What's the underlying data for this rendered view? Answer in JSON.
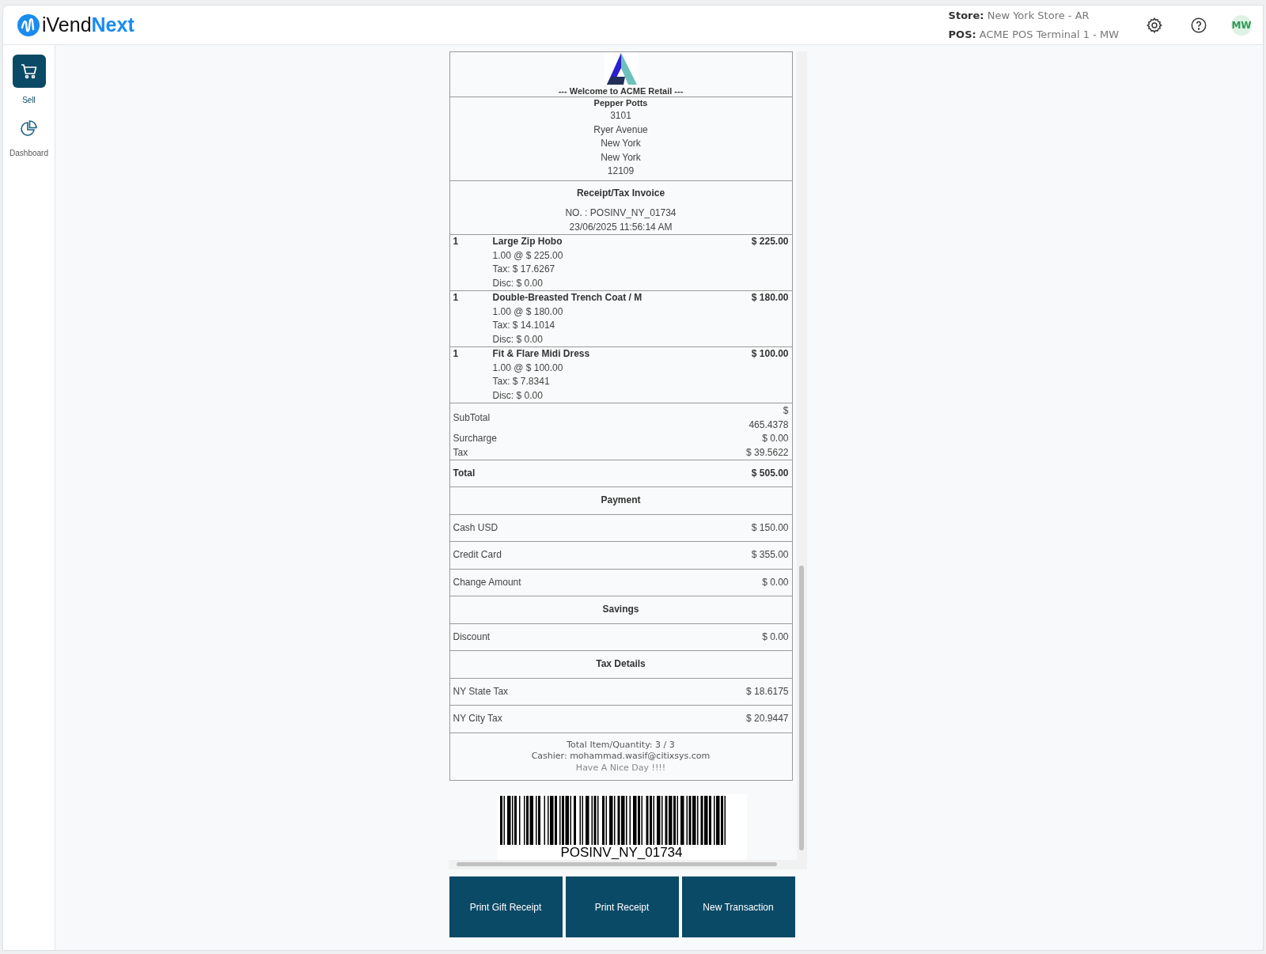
{
  "header": {
    "brand_prefix": "iVend",
    "brand_suffix": "Next",
    "store_label": "Store:",
    "store": "New York Store - AR",
    "pos_label": "POS:",
    "pos": "ACME POS Terminal 1 - MW",
    "avatar": "MW"
  },
  "sidebar": {
    "items": [
      {
        "label": "Sell",
        "kind": "cart",
        "selected": true
      },
      {
        "label": "Dashboard",
        "kind": "chart",
        "selected": false
      }
    ]
  },
  "receipt": {
    "welcome": "--- Welcome to ACME Retail ---",
    "customer": "Pepper Potts",
    "address": [
      "3101",
      "Ryer Avenue",
      "New York",
      "New York",
      "12109"
    ],
    "title": "Receipt/Tax Invoice",
    "number": "NO. : POSINV_NY_01734",
    "date": "23/06/2025 11:56:14 AM",
    "items": [
      {
        "qty": "1",
        "name": "Large Zip Hobo",
        "amount": "$ 225.00",
        "details": [
          "1.00 @ $ 225.00",
          "Tax: $ 17.6267",
          "Disc: $ 0.00"
        ]
      },
      {
        "qty": "1",
        "name": "Double-Breasted Trench Coat / M",
        "amount": "$ 180.00",
        "details": [
          "1.00 @ $ 180.00",
          "Tax: $ 14.1014",
          "Disc: $ 0.00"
        ]
      },
      {
        "qty": "1",
        "name": "Fit & Flare Midi Dress",
        "amount": "$ 100.00",
        "details": [
          "1.00 @ $ 100.00",
          "Tax: $ 7.8341",
          "Disc: $ 0.00"
        ]
      }
    ],
    "summary": [
      {
        "label": "SubTotal",
        "value": "$ 465.4378",
        "wrapped": true
      },
      {
        "label": "Surcharge",
        "value": "$ 0.00",
        "wrapped": false
      },
      {
        "label": "Tax",
        "value": "$ 39.5622",
        "wrapped": false
      }
    ],
    "total": {
      "label": "Total",
      "value": "$ 505.00"
    },
    "sections": [
      {
        "heading": "Payment",
        "rows": [
          {
            "label": "Cash USD",
            "value": "$ 150.00"
          },
          {
            "label": "Credit Card",
            "value": "$ 355.00"
          },
          {
            "label": "Change Amount",
            "value": "$ 0.00"
          }
        ]
      },
      {
        "heading": "Savings",
        "rows": [
          {
            "label": "Discount",
            "value": "$ 0.00"
          }
        ]
      },
      {
        "heading": "Tax Details",
        "rows": [
          {
            "label": "NY State Tax",
            "value": "$ 18.6175"
          },
          {
            "label": "NY City Tax",
            "value": "$ 20.9447"
          }
        ]
      }
    ],
    "footer": [
      "Total Item/Quantity: 3 / 3",
      "Cashier: mohammad.wasif@citixsys.com",
      "Have A Nice Day !!!!"
    ],
    "barcode_text": "POSINV_NY_01734"
  },
  "buttons": [
    "Print Gift Receipt",
    "Print Receipt",
    "New Transaction"
  ]
}
